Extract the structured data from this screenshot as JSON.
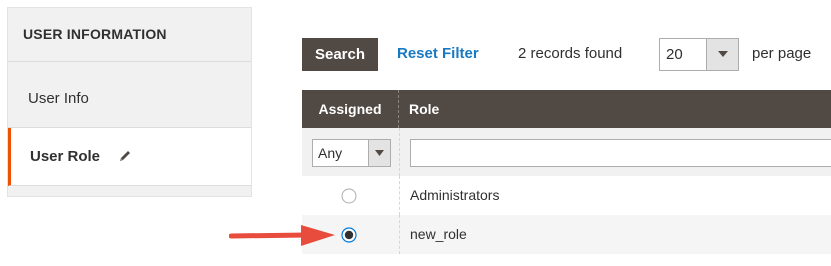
{
  "sidebar": {
    "title": "USER INFORMATION",
    "items": [
      {
        "label": "User Info",
        "active": false
      },
      {
        "label": "User Role",
        "active": true,
        "icon": "pencil-icon"
      }
    ],
    "accent_color": "#eb5202"
  },
  "toolbar": {
    "search_label": "Search",
    "reset_label": "Reset Filter",
    "records_text": "2 records found",
    "per_page_value": "20",
    "per_page_label": "per page"
  },
  "grid": {
    "columns": [
      "Assigned",
      "Role"
    ],
    "filters": {
      "assigned_value": "Any",
      "role_value": ""
    },
    "rows": [
      {
        "assigned": false,
        "role": "Administrators"
      },
      {
        "assigned": true,
        "role": "new_role"
      }
    ],
    "header_color": "#514943"
  },
  "annotation": {
    "arrow_color": "#e74c3c"
  }
}
